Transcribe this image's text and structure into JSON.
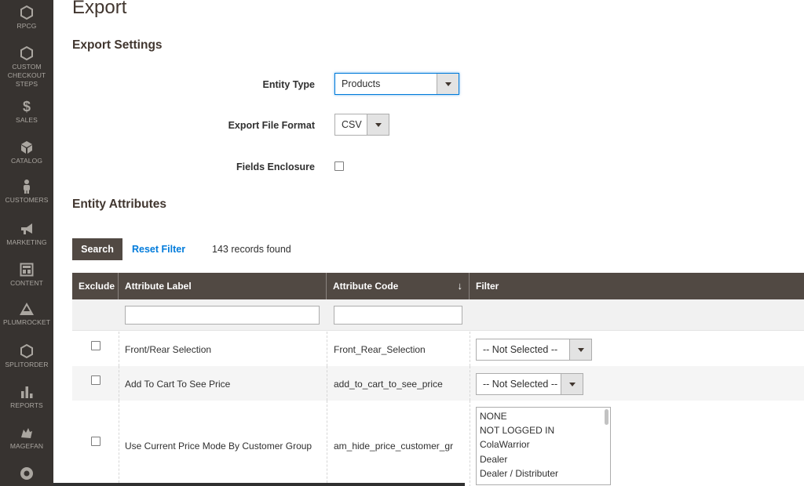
{
  "sidebar": {
    "items": [
      {
        "label": "RPCG",
        "icon": "hexagon-icon"
      },
      {
        "label": "CUSTOM CHECKOUT STEPS",
        "icon": "hexagon-icon"
      },
      {
        "label": "SALES",
        "icon": "dollar-icon"
      },
      {
        "label": "CATALOG",
        "icon": "cube-icon"
      },
      {
        "label": "CUSTOMERS",
        "icon": "person-icon"
      },
      {
        "label": "MARKETING",
        "icon": "megaphone-icon"
      },
      {
        "label": "CONTENT",
        "icon": "layout-icon"
      },
      {
        "label": "PLUMROCKET",
        "icon": "mountain-icon"
      },
      {
        "label": "SPLITORDER",
        "icon": "hexagon-icon"
      },
      {
        "label": "REPORTS",
        "icon": "bar-chart-icon"
      },
      {
        "label": "MAGEFAN",
        "icon": "magefan-icon"
      }
    ]
  },
  "page": {
    "title": "Export",
    "settings_title": "Export Settings",
    "attributes_title": "Entity Attributes"
  },
  "settings": {
    "entity_type_label": "Entity Type",
    "entity_type_value": "Products",
    "file_format_label": "Export File Format",
    "file_format_value": "CSV",
    "fields_enclosure_label": "Fields Enclosure"
  },
  "toolbar": {
    "search_label": "Search",
    "reset_label": "Reset Filter",
    "records": "143 records found"
  },
  "grid": {
    "columns": [
      "Exclude",
      "Attribute Label",
      "Attribute Code",
      "Filter"
    ],
    "rows": [
      {
        "label": "Front/Rear Selection",
        "code": "Front_Rear_Selection",
        "filter": "-- Not Selected --"
      },
      {
        "label": "Add To Cart To See Price",
        "code": "add_to_cart_to_see_price",
        "filter": "-- Not Selected --"
      },
      {
        "label": "Use Current Price Mode By Customer Group",
        "code": "am_hide_price_customer_gr",
        "options": [
          "NONE",
          "NOT LOGGED IN",
          "ColaWarrior",
          "Dealer",
          "Dealer / Distributer"
        ]
      }
    ]
  }
}
